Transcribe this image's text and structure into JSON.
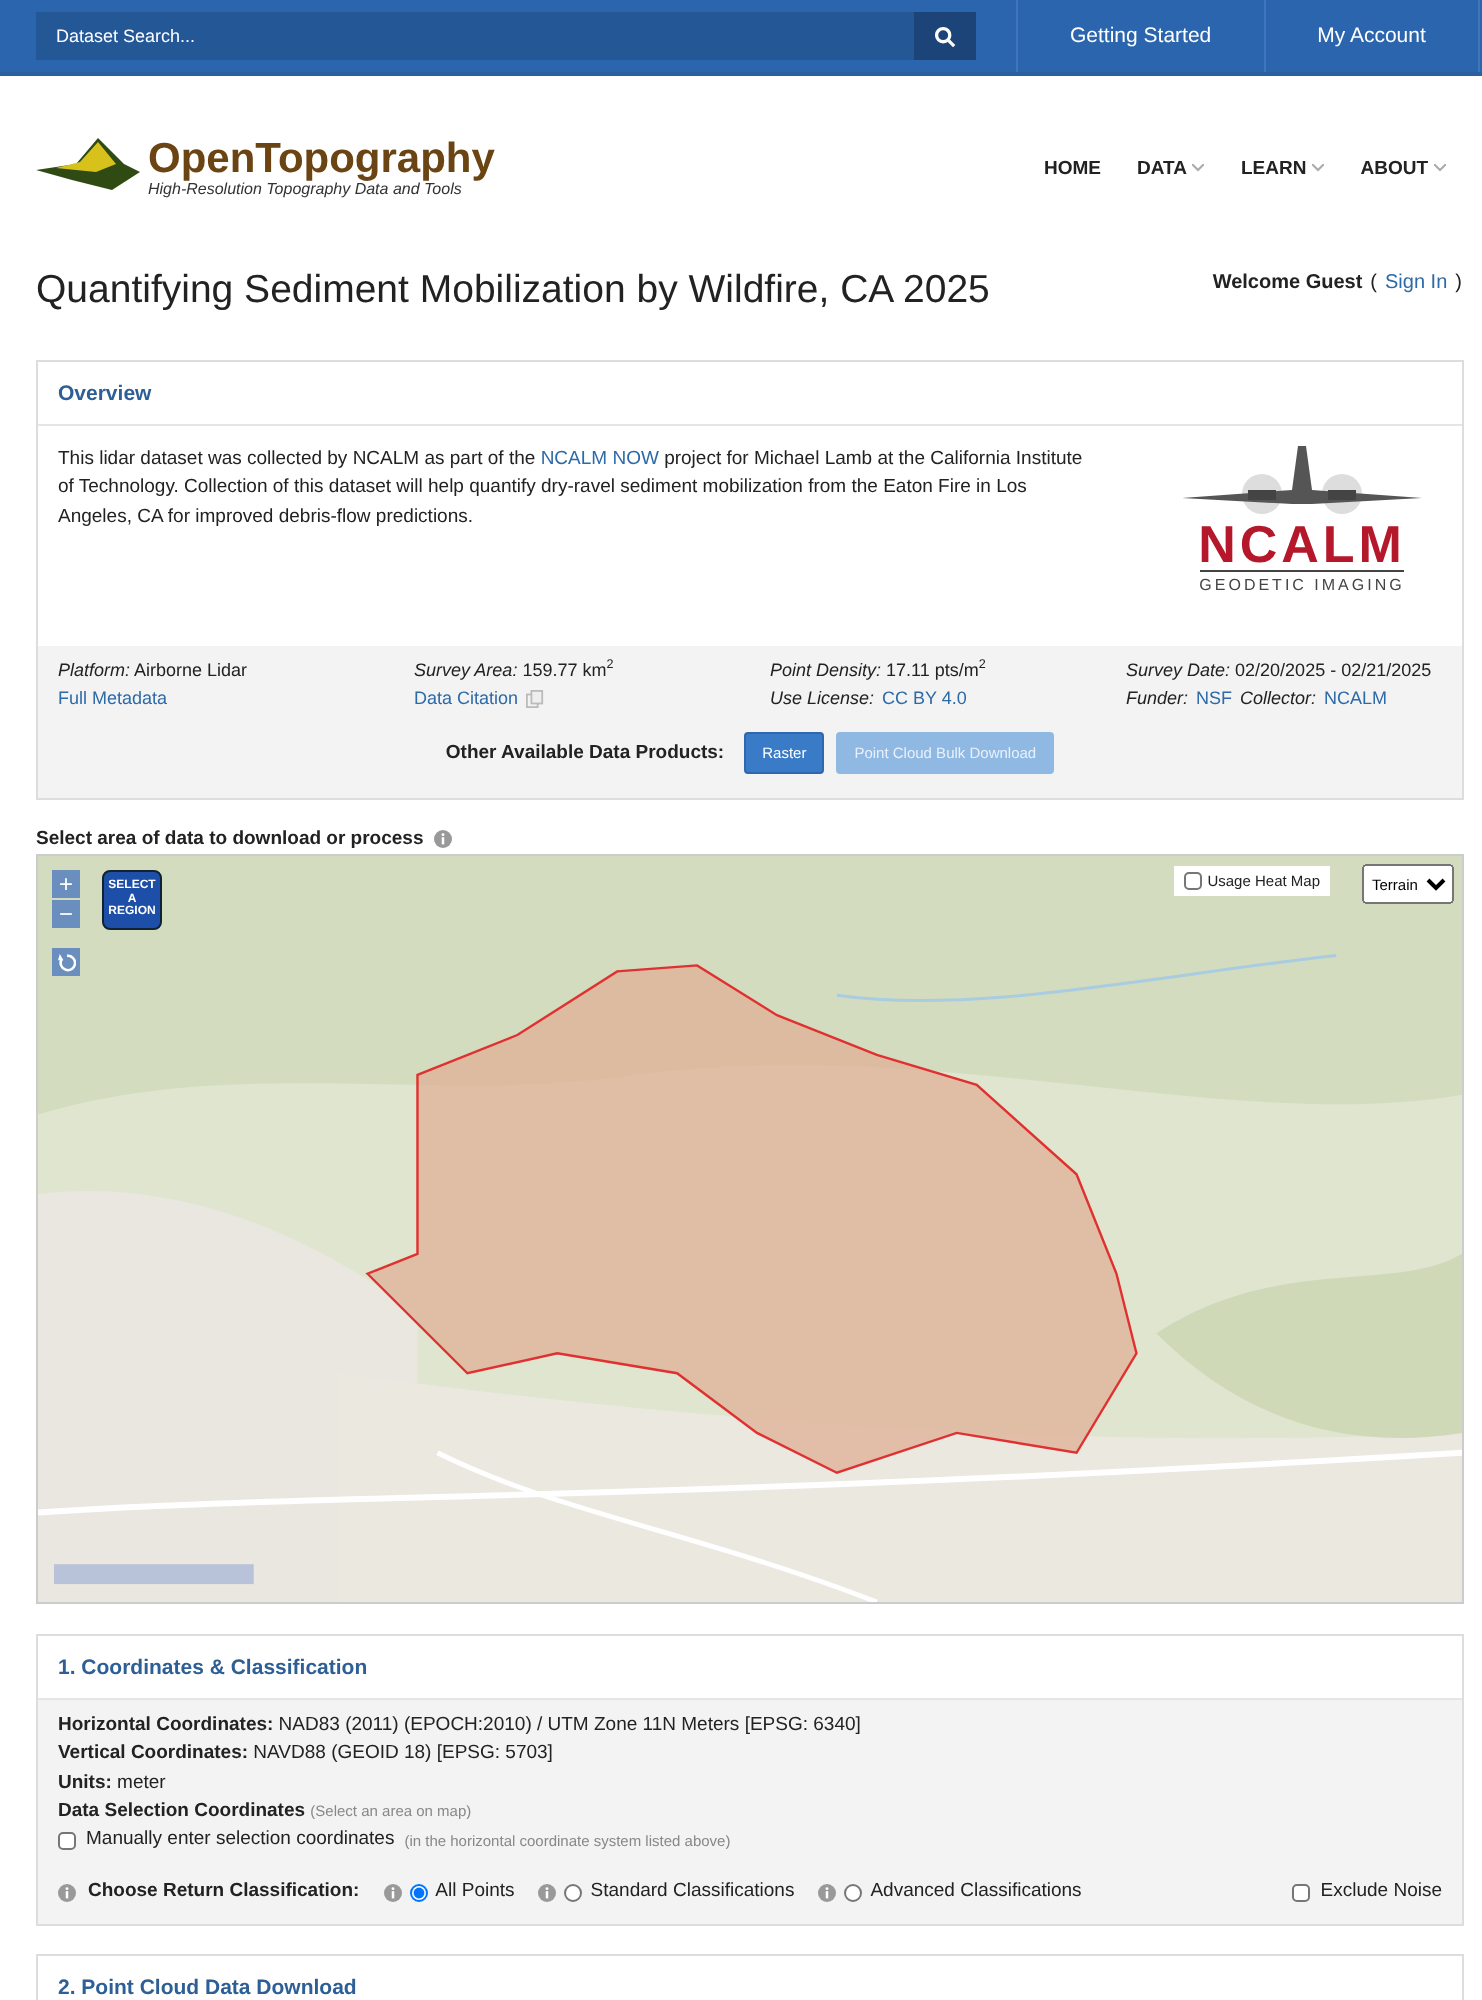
{
  "top_bar": {
    "search": {
      "placeholder": "Dataset Search..."
    },
    "links": [
      "Getting Started",
      "My Account"
    ]
  },
  "header": {
    "logo": {
      "title": "OpenTopography",
      "tagline": "High-Resolution Topography Data and Tools"
    },
    "nav": [
      {
        "label": "HOME",
        "dropdown": false
      },
      {
        "label": "DATA",
        "dropdown": true
      },
      {
        "label": "LEARN",
        "dropdown": true
      },
      {
        "label": "ABOUT",
        "dropdown": true
      }
    ]
  },
  "page_title": "Quantifying Sediment Mobilization by Wildfire, CA 2025",
  "account": {
    "greeting": "Welcome Guest",
    "open": "(",
    "link": "Sign In",
    "close": ")"
  },
  "overview": {
    "heading": "Overview",
    "description": {
      "before": "This lidar dataset was collected by NCALM as part of the",
      "link": "NCALM NOW",
      "after": "project for Michael Lamb at the California Institute of Technology. Collection of this dataset will help quantify dry-ravel sediment mobilization from the Eaton Fire in Los Angeles, CA for improved debris-flow predictions."
    },
    "partner_logo": {
      "name": "NCALM",
      "subtitle": "GEODETIC IMAGING"
    },
    "metadata": [
      [
        [
          {
            "text": "*Platform:* Airborne Lidar"
          }
        ],
        [
          {
            "link": "Full Metadata"
          }
        ]
      ],
      [
        [
          {
            "text": "*Survey Area:* 159.77 km$^{2}$"
          }
        ],
        [
          {
            "link": "Data Citation",
            "copy": true
          }
        ]
      ],
      [
        [
          {
            "text": "*Point Density:* 17.11 pts/m$^{2}$"
          }
        ],
        [
          {
            "text": "*Use License:*",
            "link": "CC BY 4.0"
          }
        ]
      ],
      [
        [
          {
            "text": "*Survey Date:* 02/20/2025 - 02/21/2025"
          }
        ],
        [
          {
            "text": "*Funder:*",
            "link": "NSF"
          },
          {
            "text": "*Collector:*",
            "link": "NCALM"
          }
        ]
      ]
    ],
    "products": {
      "label": "Other Available Data Products:",
      "buttons": [
        {
          "label": "Raster",
          "disabled": false
        },
        {
          "label": "Point Cloud Bulk Download",
          "disabled": true
        }
      ]
    }
  },
  "map": {
    "heading": "Select area of data to download or process",
    "controls": {
      "zoom_in": "+",
      "zoom_out": "−",
      "select_region": "SELECT A REGION"
    },
    "heat_map": {
      "label": "Usage Heat Map",
      "checked": false
    },
    "basemap": {
      "value": "Terrain"
    }
  },
  "coordinates": {
    "heading": "1. Coordinates & Classification",
    "lines": [
      "**Horizontal Coordinates:** NAD83 (2011) (EPOCH:2010) / UTM Zone 11N Meters [EPSG: 6340]",
      "**Vertical Coordinates:** NAVD88 (GEOID 18) [EPSG: 5703]",
      "**Units:** meter"
    ],
    "selection": {
      "label": "Data Selection Coordinates",
      "hint": "(Select an area on map)"
    },
    "manual": {
      "label": "Manually enter selection coordinates",
      "hint": "(in the horizontal coordinate system listed above)",
      "checked": false
    },
    "classification": {
      "label": "Choose Return Classification:",
      "options": [
        {
          "label": "All Points",
          "selected": true
        },
        {
          "label": "Standard Classifications",
          "selected": false
        },
        {
          "label": "Advanced Classifications",
          "selected": false
        }
      ]
    },
    "exclude_noise": {
      "label": "Exclude Noise",
      "checked": false
    }
  },
  "next_section": {
    "heading": "2. Point Cloud Data Download"
  }
}
